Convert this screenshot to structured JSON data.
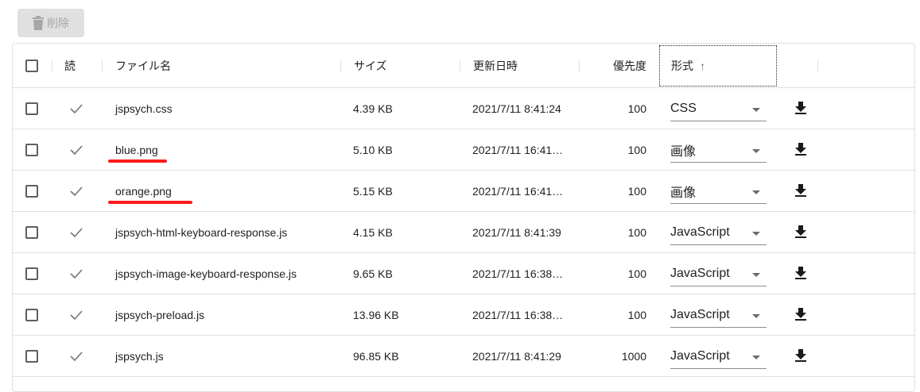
{
  "toolbar": {
    "delete_label": "削除",
    "delete_icon": "trash-icon"
  },
  "columns": {
    "read": "読",
    "filename": "ファイル名",
    "size": "サイズ",
    "updated": "更新日時",
    "priority": "優先度",
    "format": "形式",
    "sort_indicator": "↑"
  },
  "rows": [
    {
      "filename": "jspsych.css",
      "size": "4.39 KB",
      "updated": "2021/7/11 8:41:24",
      "priority": "100",
      "format": "CSS",
      "highlighted": false
    },
    {
      "filename": "blue.png",
      "size": "5.10 KB",
      "updated": "2021/7/11 16:41…",
      "priority": "100",
      "format": "画像",
      "highlighted": true
    },
    {
      "filename": "orange.png",
      "size": "5.15 KB",
      "updated": "2021/7/11 16:41…",
      "priority": "100",
      "format": "画像",
      "highlighted": true
    },
    {
      "filename": "jspsych-html-keyboard-response.js",
      "size": "4.15 KB",
      "updated": "2021/7/11 8:41:39",
      "priority": "100",
      "format": "JavaScript",
      "highlighted": false
    },
    {
      "filename": "jspsych-image-keyboard-response.js",
      "size": "9.65 KB",
      "updated": "2021/7/11 16:38…",
      "priority": "100",
      "format": "JavaScript",
      "highlighted": false
    },
    {
      "filename": "jspsych-preload.js",
      "size": "13.96 KB",
      "updated": "2021/7/11 16:38…",
      "priority": "100",
      "format": "JavaScript",
      "highlighted": false
    },
    {
      "filename": "jspsych.js",
      "size": "96.85 KB",
      "updated": "2021/7/11 8:41:29",
      "priority": "1000",
      "format": "JavaScript",
      "highlighted": false
    }
  ],
  "colors": {
    "highlight_underline": "#ff1a1a",
    "border": "#e0e0e0"
  }
}
